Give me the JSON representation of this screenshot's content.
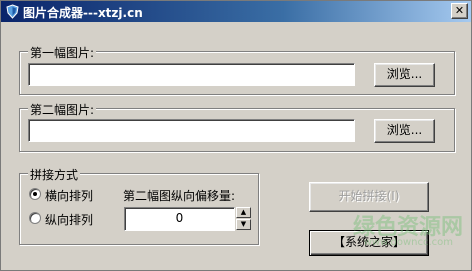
{
  "window": {
    "title": "图片合成器---xtzj.cn",
    "close_label": "✕"
  },
  "image1": {
    "group_label": "第一幅图片:",
    "path_value": "",
    "browse_label": "浏览..."
  },
  "image2": {
    "group_label": "第二幅图片:",
    "path_value": "",
    "browse_label": "浏览..."
  },
  "join_mode": {
    "group_label": "拼接方式",
    "options": [
      {
        "label": "横向排列",
        "checked": true
      },
      {
        "label": "纵向排列",
        "checked": false
      }
    ],
    "offset_label": "第二幅图纵向偏移量:",
    "offset_value": "0"
  },
  "actions": {
    "start_label": "开始拼接(I)",
    "link_label": "【系统之家】"
  },
  "watermark": {
    "text": "绿色资源网",
    "sub": "www.downcc.com"
  },
  "colors": {
    "titlebar_start": "#0a246a",
    "titlebar_end": "#a6caf0",
    "face": "#d4d0c8"
  },
  "icons": {
    "app": "shield-icon",
    "close": "close-icon",
    "spin_up": "spin-up-icon",
    "spin_down": "spin-down-icon"
  }
}
